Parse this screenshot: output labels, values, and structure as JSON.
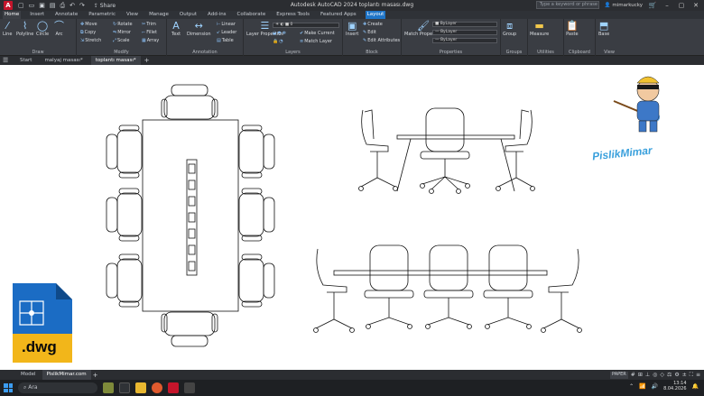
{
  "titlebar": {
    "logo": "A",
    "share_label": "Share",
    "title": "Autodesk AutoCAD 2024   toplantı masası.dwg",
    "search_placeholder": "Type a keyword or phrase",
    "user": "mimarkucky"
  },
  "ribbon_tabs": [
    "Home",
    "Insert",
    "Annotate",
    "Parametric",
    "View",
    "Manage",
    "Output",
    "Add-ins",
    "Collaborate",
    "Express Tools",
    "Featured Apps",
    "Layout"
  ],
  "panels": {
    "draw": "Draw",
    "modify": "Modify",
    "annotation": "Annotation",
    "layers": "Layers",
    "block": "Block",
    "properties": "Properties",
    "groups": "Groups",
    "utilities": "Utilities",
    "clipboard": "Clipboard",
    "view": "View"
  },
  "tools": {
    "line": "Line",
    "polyline": "Polyline",
    "circle": "Circle",
    "arc": "Arc",
    "move": "Move",
    "rotate": "Rotate",
    "trim": "Trim",
    "copy": "Copy",
    "mirror": "Mirror",
    "fillet": "Fillet",
    "stretch": "Stretch",
    "scale": "Scale",
    "array": "Array",
    "text": "Text",
    "dimension": "Dimension",
    "linear": "Linear",
    "leader": "Leader",
    "table": "Table",
    "layer_properties": "Layer Properties",
    "make_current": "Make Current",
    "match_layer": "Match Layer",
    "insert": "Insert",
    "create": "Create",
    "edit": "Edit",
    "edit_attributes": "Edit Attributes",
    "match_properties": "Match Properties",
    "group": "Group",
    "measure": "Measure",
    "paste": "Paste",
    "base": "Base",
    "bylayer": "ByLayer",
    "layer_value": "0"
  },
  "doc_tabs": [
    "Start",
    "malyaj masası*",
    "toplantı masası*"
  ],
  "layout_tabs": [
    "Model",
    "PislikMimar.com"
  ],
  "status": {
    "paper": "PAPER"
  },
  "watermark": {
    "brand": "PislikMimar",
    "file_badge": ".dwg"
  },
  "taskbar": {
    "search": "Ara",
    "time": "13:14",
    "date": "8.04.2026"
  },
  "colors": {
    "accent": "#1f75c8",
    "app_red": "#c5152b",
    "ribbon_bg": "#3a3d43",
    "dwg_blue": "#1b6cc4",
    "dwg_yellow": "#f2b61a"
  }
}
